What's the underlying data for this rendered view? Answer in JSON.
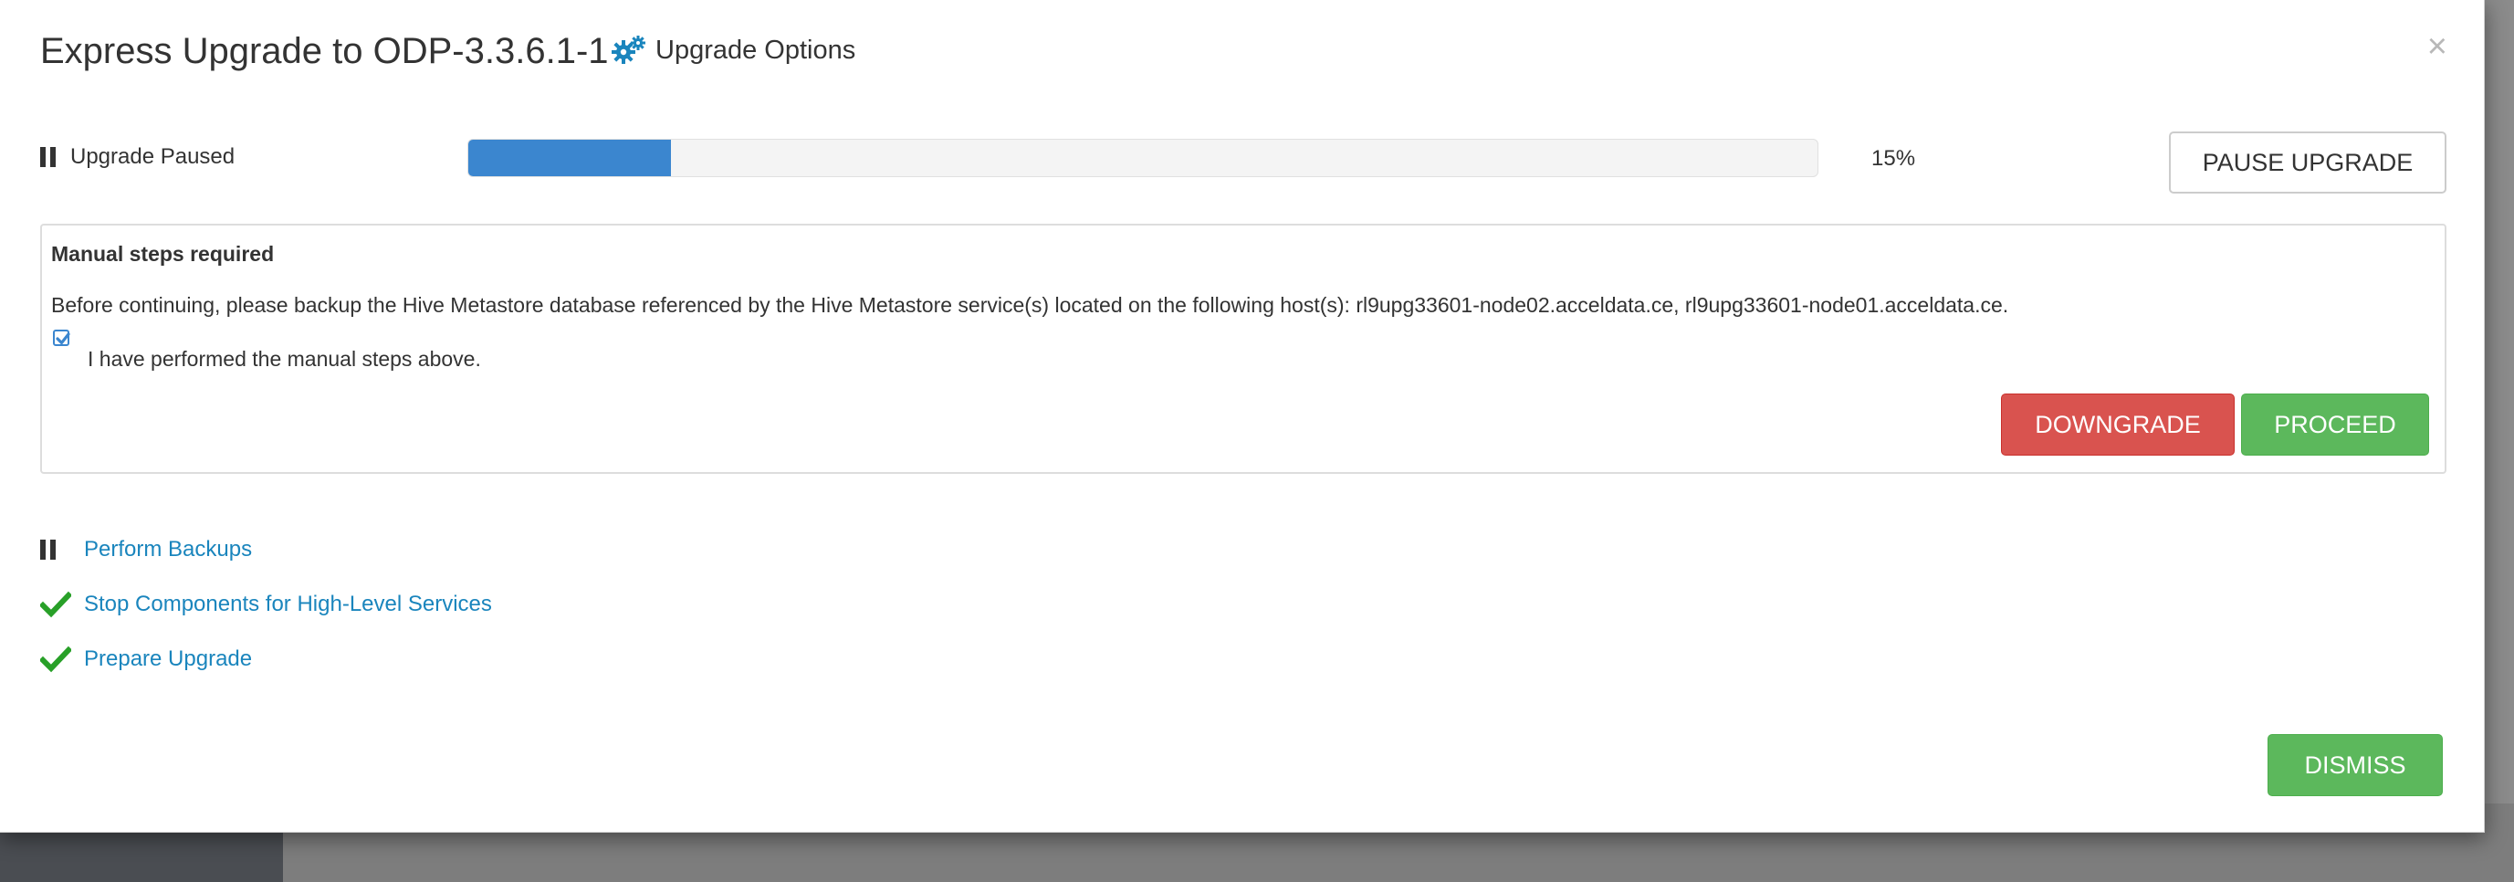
{
  "modal": {
    "title": "Express Upgrade to ODP-3.3.6.1-1",
    "upgrade_options_label": "Upgrade Options",
    "close_label": "×"
  },
  "status": {
    "label": "Upgrade Paused",
    "progress_percent": 15,
    "progress_text": "15%",
    "pause_button_label": "PAUSE UPGRADE"
  },
  "manual_steps": {
    "title": "Manual steps required",
    "message": "Before continuing, please backup the Hive Metastore database referenced by the Hive Metastore service(s) located on the following host(s): rl9upg33601-node02.acceldata.ce, rl9upg33601-node01.acceldata.ce.",
    "checkbox_label": "I have performed the manual steps above.",
    "checkbox_checked": true,
    "downgrade_label": "DOWNGRADE",
    "proceed_label": "PROCEED"
  },
  "steps": [
    {
      "label": "Perform Backups",
      "state": "paused",
      "icon": "pause-icon"
    },
    {
      "label": "Stop Components for High-Level Services",
      "state": "done",
      "icon": "check-icon"
    },
    {
      "label": "Prepare Upgrade",
      "state": "done",
      "icon": "check-icon"
    }
  ],
  "footer": {
    "dismiss_label": "DISMISS"
  },
  "colors": {
    "accent_blue": "#3b86cf",
    "link_blue": "#1a85bd",
    "success_green": "#5cb85c",
    "danger_red": "#d9534f",
    "check_green": "#28a028"
  }
}
